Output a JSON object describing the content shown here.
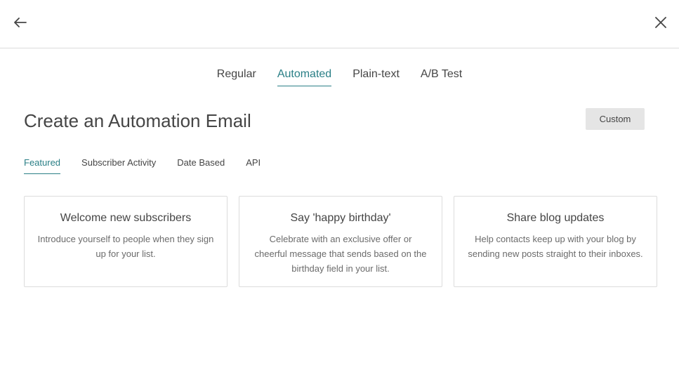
{
  "header": {
    "back_icon": "arrow-left-icon",
    "close_icon": "close-icon"
  },
  "type_tabs": [
    {
      "label": "Regular",
      "active": false
    },
    {
      "label": "Automated",
      "active": true
    },
    {
      "label": "Plain-text",
      "active": false
    },
    {
      "label": "A/B Test",
      "active": false
    }
  ],
  "page": {
    "title": "Create an Automation Email",
    "custom_label": "Custom"
  },
  "category_tabs": [
    {
      "label": "Featured",
      "active": true
    },
    {
      "label": "Subscriber Activity",
      "active": false
    },
    {
      "label": "Date Based",
      "active": false
    },
    {
      "label": "API",
      "active": false
    }
  ],
  "cards": [
    {
      "title": "Welcome new subscribers",
      "description": "Introduce yourself to people when they sign up for your list."
    },
    {
      "title": "Say 'happy birthday'",
      "description": "Celebrate with an exclusive offer or cheerful message that sends based on the birthday field in your list."
    },
    {
      "title": "Share blog updates",
      "description": "Help contacts keep up with your blog by sending new posts straight to their inboxes."
    }
  ],
  "colors": {
    "accent": "#2a7f86",
    "text": "#454545",
    "border": "#dcdcdc",
    "button_bg": "#e5e5e5"
  }
}
